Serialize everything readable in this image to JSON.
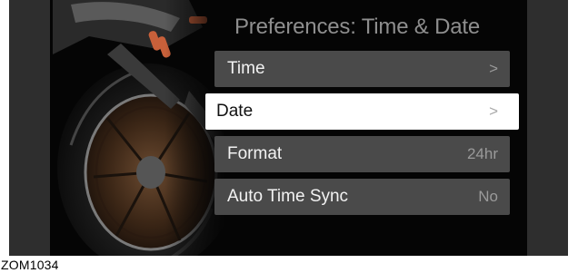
{
  "screen": {
    "title": "Preferences: Time & Date"
  },
  "menu": {
    "items": [
      {
        "label": "Time",
        "value": ">",
        "selected": false
      },
      {
        "label": "Date",
        "value": ">",
        "selected": true
      },
      {
        "label": "Format",
        "value": "24hr",
        "selected": false
      },
      {
        "label": "Auto Time Sync",
        "value": "No",
        "selected": false
      }
    ]
  },
  "figure": {
    "code": "ZOM1034"
  },
  "colors": {
    "background": "#050505",
    "item_bg": "#4a4a4a",
    "item_selected_bg": "#ffffff",
    "accent_orange": "#c8603a"
  }
}
